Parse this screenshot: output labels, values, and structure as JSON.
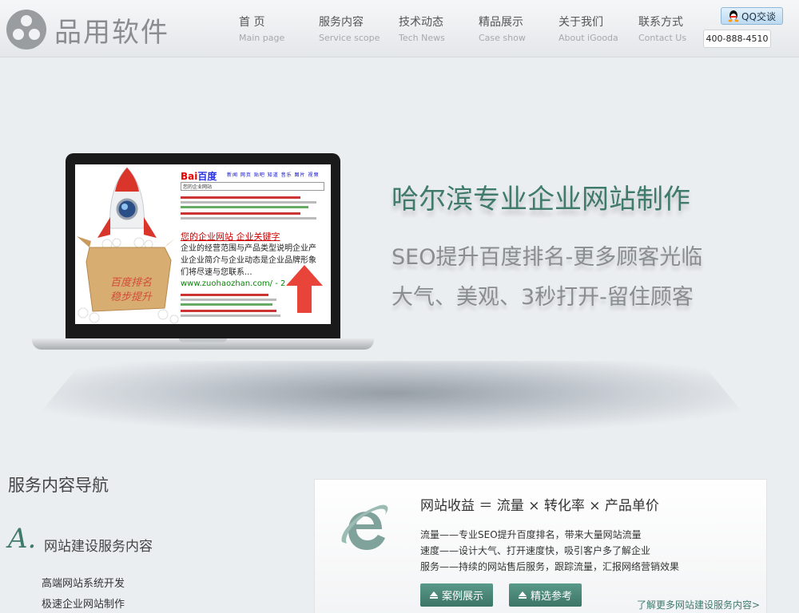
{
  "header": {
    "logo_text": "品用软件",
    "nav": [
      {
        "cn": "首 页",
        "en": "Main page"
      },
      {
        "cn": "服务内容",
        "en": "Service scope"
      },
      {
        "cn": "技术动态",
        "en": "Tech News"
      },
      {
        "cn": "精品展示",
        "en": "Case show"
      },
      {
        "cn": "关于我们",
        "en": "About iGooda"
      },
      {
        "cn": "联系方式",
        "en": "Contact Us"
      }
    ],
    "qq_label": "QQ交谈",
    "phone": "400-888-4510"
  },
  "hero": {
    "title": "哈尔滨专业企业网站制作",
    "subtitle_1": "SEO提升百度排名-更多顾客光临",
    "subtitle_2": "大气、美观、3秒打开-留住顾客",
    "screen": {
      "baidu_logo_a": "Bai",
      "baidu_logo_b": "百度",
      "tabs": "新闻 网页 贴吧 知道 音乐 图片 视频",
      "search_text": "您的企业网站",
      "result_title": "您的企业网站 企业关键字",
      "result_line_1": "企业的经营范围与产品类型说明企业产",
      "result_line_2": "业企业简介与企业动态是企业品牌形象",
      "result_line_3": "们将尽速与您联系...",
      "result_url": "www.zuohaozhan.com/ - 2",
      "box_label_1": "百度排名",
      "box_label_2": "稳步提升"
    }
  },
  "services": {
    "title": "服务内容导航",
    "letter": "A.",
    "subtitle": "网站建设服务内容",
    "links": [
      "高端网站系统开发",
      "极速企业网站制作"
    ]
  },
  "panel": {
    "formula": "网站收益 ＝ 流量 × 转化率 × 产品单价",
    "lines": [
      "流量——专业SEO提升百度排名，带来大量网站流量",
      "速度——设计大气、打开速度快，吸引客户多了解企业",
      "服务——持续的网站售后服务，跟踪流量，汇报网络营销效果"
    ],
    "btn_cases": "案例展示",
    "btn_refs": "精选参考",
    "more_link": "了解更多网站建设服务内容>"
  },
  "colors": {
    "accent": "#3f7a6c",
    "background": "#ebeef1"
  }
}
